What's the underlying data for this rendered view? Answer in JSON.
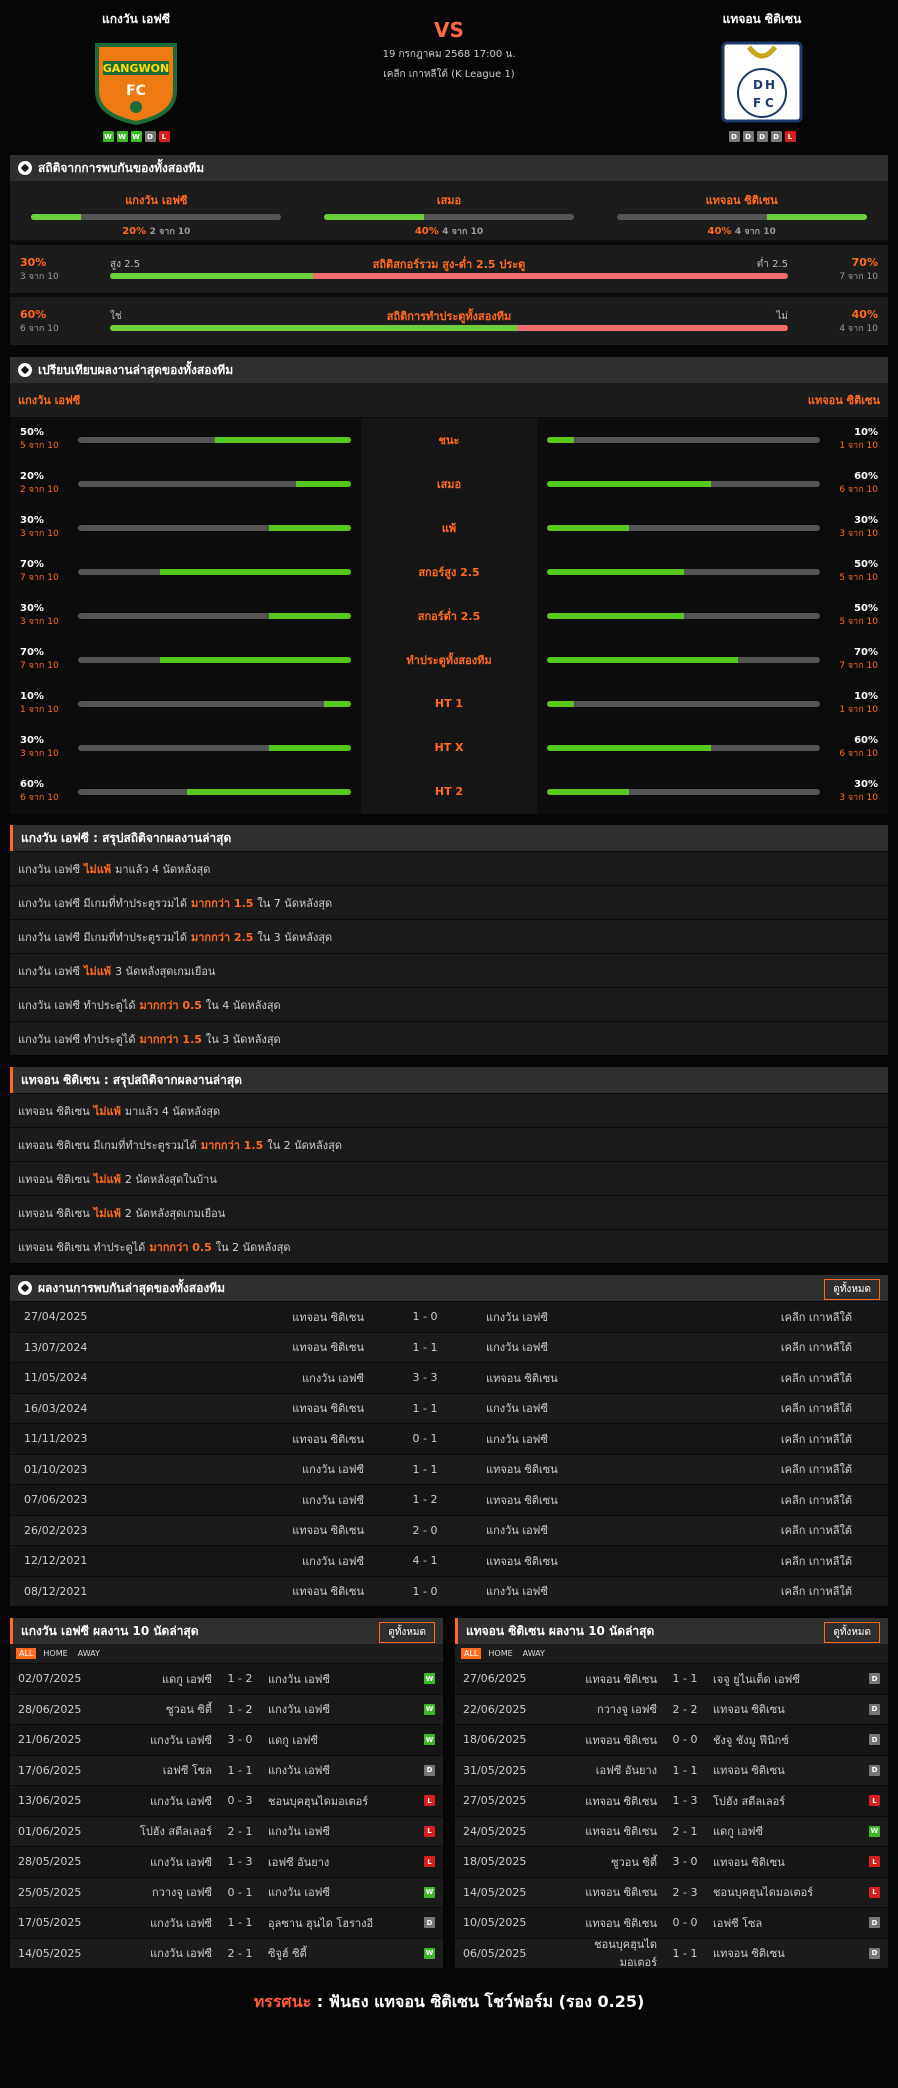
{
  "header": {
    "home": "แกงวัน เอฟซี",
    "away": "แทจอน ซิติเซน",
    "vs": "VS",
    "date": "19 กรกฎาคม 2568 17:00 น.",
    "league": "เคลีก เกาหลีใต้ (K League 1)",
    "home_form": [
      "W",
      "W",
      "W",
      "D",
      "L"
    ],
    "away_form": [
      "D",
      "D",
      "D",
      "D",
      "L"
    ],
    "home_logo_text": "GANGWON",
    "home_logo_sub": "FC",
    "away_logo_text": "DHFC"
  },
  "h2h": {
    "title": "สถิติจากการพบกันของทั้งสองทีม",
    "cols": [
      {
        "label": "แกงวัน เอฟซี",
        "pct": "20%",
        "of": "2 จาก 10",
        "fill": 20
      },
      {
        "label": "เสมอ",
        "pct": "40%",
        "of": "4 จาก 10",
        "fill": 40
      },
      {
        "label": "แทจอน ซิติเซน",
        "pct": "40%",
        "of": "4 จาก 10",
        "fill": 40
      }
    ],
    "ou": [
      {
        "title": "สถิติสกอร์รวม สูง-ต่ำ 2.5 ประตู",
        "left_pct": "30%",
        "left_of": "3 จาก 10",
        "left_lbl": "สูง 2.5",
        "right_lbl": "ต่ำ 2.5",
        "right_pct": "70%",
        "right_of": "7 จาก 10",
        "fill": 30
      },
      {
        "title": "สถิติการทำประตูทั้งสองทีม",
        "left_pct": "60%",
        "left_of": "6 จาก 10",
        "left_lbl": "ใช่",
        "right_lbl": "ไม่",
        "right_pct": "40%",
        "right_of": "4 จาก 10",
        "fill": 60
      }
    ]
  },
  "compare": {
    "title": "เปรียบเทียบผลงานล่าสุดของทั้งสองทีม",
    "home": "แกงวัน เอฟซี",
    "away": "แทจอน ซิติเซน",
    "rows": [
      {
        "label": "ชนะ",
        "hp": "50%",
        "ho": "5 จาก 10",
        "hf": 50,
        "ap": "10%",
        "ao": "1 จาก 10",
        "af": 10
      },
      {
        "label": "เสมอ",
        "hp": "20%",
        "ho": "2 จาก 10",
        "hf": 20,
        "ap": "60%",
        "ao": "6 จาก 10",
        "af": 60
      },
      {
        "label": "แพ้",
        "hp": "30%",
        "ho": "3 จาก 10",
        "hf": 30,
        "ap": "30%",
        "ao": "3 จาก 10",
        "af": 30
      },
      {
        "label": "สกอร์สูง 2.5",
        "hp": "70%",
        "ho": "7 จาก 10",
        "hf": 70,
        "ap": "50%",
        "ao": "5 จาก 10",
        "af": 50
      },
      {
        "label": "สกอร์ต่ำ 2.5",
        "hp": "30%",
        "ho": "3 จาก 10",
        "hf": 30,
        "ap": "50%",
        "ao": "5 จาก 10",
        "af": 50
      },
      {
        "label": "ทำประตูทั้งสองทีม",
        "hp": "70%",
        "ho": "7 จาก 10",
        "hf": 70,
        "ap": "70%",
        "ao": "7 จาก 10",
        "af": 70
      },
      {
        "label": "HT 1",
        "hp": "10%",
        "ho": "1 จาก 10",
        "hf": 10,
        "ap": "10%",
        "ao": "1 จาก 10",
        "af": 10
      },
      {
        "label": "HT X",
        "hp": "30%",
        "ho": "3 จาก 10",
        "hf": 30,
        "ap": "60%",
        "ao": "6 จาก 10",
        "af": 60
      },
      {
        "label": "HT 2",
        "hp": "60%",
        "ho": "6 จาก 10",
        "hf": 60,
        "ap": "30%",
        "ao": "3 จาก 10",
        "af": 30
      }
    ]
  },
  "home_summary": {
    "title": "แกงวัน เอฟซี : สรุปสถิติจากผลงานล่าสุด",
    "rows": [
      {
        "a": "แกงวัน เอฟซี",
        "b": "ไม่แพ้",
        "c": "มาแล้ว 4 นัดหลังสุด"
      },
      {
        "a": "แกงวัน เอฟซี มีเกมที่ทำประตูรวมได้",
        "b": "มากกว่า 1.5",
        "c": "ใน 7 นัดหลังสุด"
      },
      {
        "a": "แกงวัน เอฟซี มีเกมที่ทำประตูรวมได้",
        "b": "มากกว่า 2.5",
        "c": "ใน 3 นัดหลังสุด"
      },
      {
        "a": "แกงวัน เอฟซี",
        "b": "ไม่แพ้",
        "c": "3 นัดหลังสุดเกมเยือน"
      },
      {
        "a": "แกงวัน เอฟซี ทำประตูได้",
        "b": "มากกว่า 0.5",
        "c": "ใน 4 นัดหลังสุด"
      },
      {
        "a": "แกงวัน เอฟซี ทำประตูได้",
        "b": "มากกว่า 1.5",
        "c": "ใน 3 นัดหลังสุด"
      }
    ]
  },
  "away_summary": {
    "title": "แทจอน ซิติเซน : สรุปสถิติจากผลงานล่าสุด",
    "rows": [
      {
        "a": "แทจอน ซิติเซน",
        "b": "ไม่แพ้",
        "c": "มาแล้ว 4 นัดหลังสุด"
      },
      {
        "a": "แทจอน ซิติเซน มีเกมที่ทำประตูรวมได้",
        "b": "มากกว่า 1.5",
        "c": "ใน 2 นัดหลังสุด"
      },
      {
        "a": "แทจอน ซิติเซน",
        "b": "ไม่แพ้",
        "c": "2 นัดหลังสุดในบ้าน"
      },
      {
        "a": "แทจอน ซิติเซน",
        "b": "ไม่แพ้",
        "c": "2 นัดหลังสุดเกมเยือน"
      },
      {
        "a": "แทจอน ซิติเซน ทำประตูได้",
        "b": "มากกว่า 0.5",
        "c": "ใน 2 นัดหลังสุด"
      }
    ]
  },
  "h2h_results": {
    "title": "ผลงานการพบกันล่าสุดของทั้งสองทีม",
    "view_all": "ดูทั้งหมด",
    "rows": [
      [
        "27/04/2025",
        "แทจอน ซิติเซน",
        "1 - 0",
        "แกงวัน เอฟซี",
        "เคลีก เกาหลีใต้"
      ],
      [
        "13/07/2024",
        "แทจอน ซิติเซน",
        "1 - 1",
        "แกงวัน เอฟซี",
        "เคลีก เกาหลีใต้"
      ],
      [
        "11/05/2024",
        "แกงวัน เอฟซี",
        "3 - 3",
        "แทจอน ซิติเซน",
        "เคลีก เกาหลีใต้"
      ],
      [
        "16/03/2024",
        "แทจอน ซิติเซน",
        "1 - 1",
        "แกงวัน เอฟซี",
        "เคลีก เกาหลีใต้"
      ],
      [
        "11/11/2023",
        "แทจอน ซิติเซน",
        "0 - 1",
        "แกงวัน เอฟซี",
        "เคลีก เกาหลีใต้"
      ],
      [
        "01/10/2023",
        "แกงวัน เอฟซี",
        "1 - 1",
        "แทจอน ซิติเซน",
        "เคลีก เกาหลีใต้"
      ],
      [
        "07/06/2023",
        "แกงวัน เอฟซี",
        "1 - 2",
        "แทจอน ซิติเซน",
        "เคลีก เกาหลีใต้"
      ],
      [
        "26/02/2023",
        "แทจอน ซิติเซน",
        "2 - 0",
        "แกงวัน เอฟซี",
        "เคลีก เกาหลีใต้"
      ],
      [
        "12/12/2021",
        "แกงวัน เอฟซี",
        "4 - 1",
        "แทจอน ซิติเซน",
        "เคลีก เกาหลีใต้"
      ],
      [
        "08/12/2021",
        "แทจอน ซิติเซน",
        "1 - 0",
        "แกงวัน เอฟซี",
        "เคลีก เกาหลีใต้"
      ]
    ]
  },
  "tabs": [
    "ALL",
    "HOME",
    "AWAY"
  ],
  "home_last": {
    "title": "แกงวัน เอฟซี ผลงาน 10 นัดล่าสุด",
    "view_all": "ดูทั้งหมด",
    "rows": [
      [
        "02/07/2025",
        "แดกู เอฟซี",
        "1 - 2",
        "แกงวัน เอฟซี",
        "W"
      ],
      [
        "28/06/2025",
        "ซูวอน ซิตี้",
        "1 - 2",
        "แกงวัน เอฟซี",
        "W"
      ],
      [
        "21/06/2025",
        "แกงวัน เอฟซี",
        "3 - 0",
        "แดกู เอฟซี",
        "W"
      ],
      [
        "17/06/2025",
        "เอฟซี โซล",
        "1 - 1",
        "แกงวัน เอฟซี",
        "D"
      ],
      [
        "13/06/2025",
        "แกงวัน เอฟซี",
        "0 - 3",
        "ชอนบุคฮุนไดมอเตอร์",
        "L"
      ],
      [
        "01/06/2025",
        "โปฮัง สตีลเลอร์",
        "2 - 1",
        "แกงวัน เอฟซี",
        "L"
      ],
      [
        "28/05/2025",
        "แกงวัน เอฟซี",
        "1 - 3",
        "เอฟซี อันยาง",
        "L"
      ],
      [
        "25/05/2025",
        "กวางจู เอฟซี",
        "0 - 1",
        "แกงวัน เอฟซี",
        "W"
      ],
      [
        "17/05/2025",
        "แกงวัน เอฟซี",
        "1 - 1",
        "อุลซาน ฮุนได โฮรางอี",
        "D"
      ],
      [
        "14/05/2025",
        "แกงวัน เอฟซี",
        "2 - 1",
        "ซิจูฮ์ ซิตี้",
        "W"
      ]
    ]
  },
  "away_last": {
    "title": "แทจอน ซิติเซน ผลงาน 10 นัดล่าสุด",
    "view_all": "ดูทั้งหมด",
    "rows": [
      [
        "27/06/2025",
        "แทจอน ซิติเซน",
        "1 - 1",
        "เจจู ยูไนเต็ด เอฟซี",
        "D"
      ],
      [
        "22/06/2025",
        "กวางจู เอฟซี",
        "2 - 2",
        "แทจอน ซิติเซน",
        "D"
      ],
      [
        "18/06/2025",
        "แทจอน ซิติเซน",
        "0 - 0",
        "ชังจู ชังมู ฟีนิกซ์",
        "D"
      ],
      [
        "31/05/2025",
        "เอฟซี อันยาง",
        "1 - 1",
        "แทจอน ซิติเซน",
        "D"
      ],
      [
        "27/05/2025",
        "แทจอน ซิติเซน",
        "1 - 3",
        "โปฮัง สตีลเลอร์",
        "L"
      ],
      [
        "24/05/2025",
        "แทจอน ซิติเซน",
        "2 - 1",
        "แดกู เอฟซี",
        "W"
      ],
      [
        "18/05/2025",
        "ซูวอน ซิตี้",
        "3 - 0",
        "แทจอน ซิติเซน",
        "L"
      ],
      [
        "14/05/2025",
        "แทจอน ซิติเซน",
        "2 - 3",
        "ชอนบุคฮุนไดมอเตอร์",
        "L"
      ],
      [
        "10/05/2025",
        "แทจอน ซิติเซน",
        "0 - 0",
        "เอฟซี โซล",
        "D"
      ],
      [
        "06/05/2025",
        "ชอนบุคฮุนไดมอเตอร์",
        "1 - 1",
        "แทจอน ซิติเซน",
        "D"
      ]
    ]
  },
  "verdict": {
    "k": "ทรรศนะ",
    "sep": ":",
    "text": "ฟันธง แทจอน ซิติเซน โชว์ฟอร์ม (รอง 0.25)"
  }
}
